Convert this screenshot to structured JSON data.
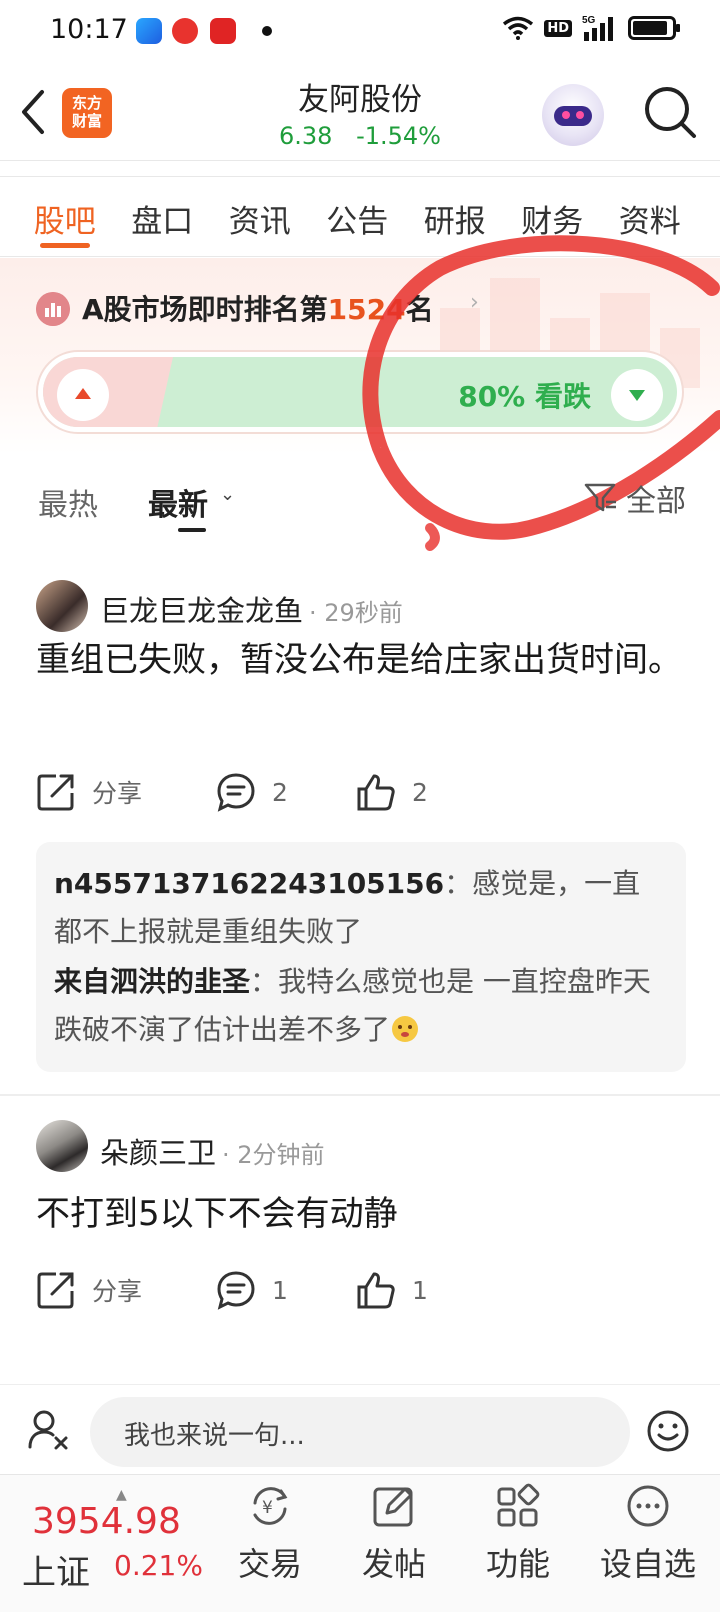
{
  "status_bar": {
    "time": "10:17",
    "hd": "HD",
    "network": "5G"
  },
  "header": {
    "logo_text_line1": "东方",
    "logo_text_line2": "财富",
    "stock_name": "友阿股份",
    "price": "6.38",
    "change_pct": "-1.54%"
  },
  "tabs": [
    {
      "label": "股吧",
      "active": true
    },
    {
      "label": "盘口"
    },
    {
      "label": "资讯"
    },
    {
      "label": "公告"
    },
    {
      "label": "研报"
    },
    {
      "label": "财务"
    },
    {
      "label": "资料"
    }
  ],
  "ranking": {
    "prefix": "A股市场即时排名第",
    "rank": "1524",
    "suffix": "名"
  },
  "sentiment": {
    "bearish_label": "80% 看跌",
    "bearish_fraction": 0.8
  },
  "sort": {
    "hot": "最热",
    "latest": "最新",
    "filter": "全部"
  },
  "posts": [
    {
      "author": "巨龙巨龙金龙鱼",
      "time": "· 29秒前",
      "body": "重组已失败，暂没公布是给庄家出货时间。",
      "share": "分享",
      "comments": "2",
      "likes": "2",
      "replies": [
        {
          "user": "n4557137162243105156",
          "text": "：感觉是，一直都不上报就是重组失败了"
        },
        {
          "user": "来自泗洪的韭圣",
          "text": "：我特么感觉也是  一直控盘昨天跌破不演了估计出差不多了"
        }
      ]
    },
    {
      "author": "朵颜三卫",
      "time": "· 2分钟前",
      "body": "不打到5以下不会有动静",
      "share": "分享",
      "comments": "1",
      "likes": "1"
    }
  ],
  "input": {
    "placeholder": "我也来说一句..."
  },
  "bottom_nav": {
    "index_value": "3954.98",
    "index_name": "上证",
    "index_change": "0.21%",
    "items": [
      "交易",
      "发帖",
      "功能",
      "设自选"
    ]
  },
  "colors": {
    "accent": "#ef6322",
    "down_green": "#1f9d3b",
    "up_red": "#e0313a"
  }
}
